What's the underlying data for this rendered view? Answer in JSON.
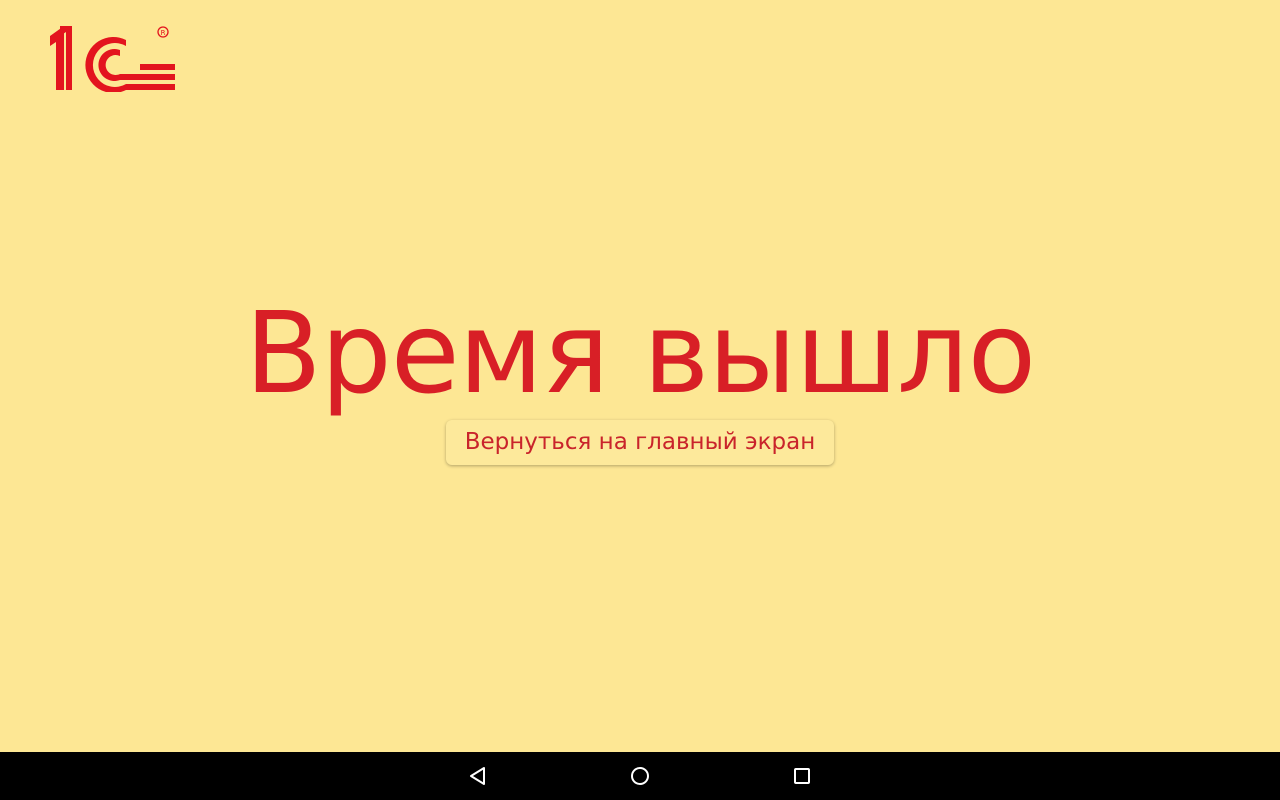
{
  "app": {
    "brand": "1С",
    "brand_mark": "®"
  },
  "main": {
    "headline": "Время вышло",
    "home_button_label": "Вернуться на главный экран"
  },
  "navigation_bar": {
    "buttons": [
      {
        "name": "back",
        "icon": "triangle-back-icon"
      },
      {
        "name": "home",
        "icon": "circle-home-icon"
      },
      {
        "name": "recents",
        "icon": "square-recents-icon"
      }
    ]
  },
  "colors": {
    "background": "#fde794",
    "brand_red": "#d81f26",
    "nav_bar": "#000000"
  }
}
